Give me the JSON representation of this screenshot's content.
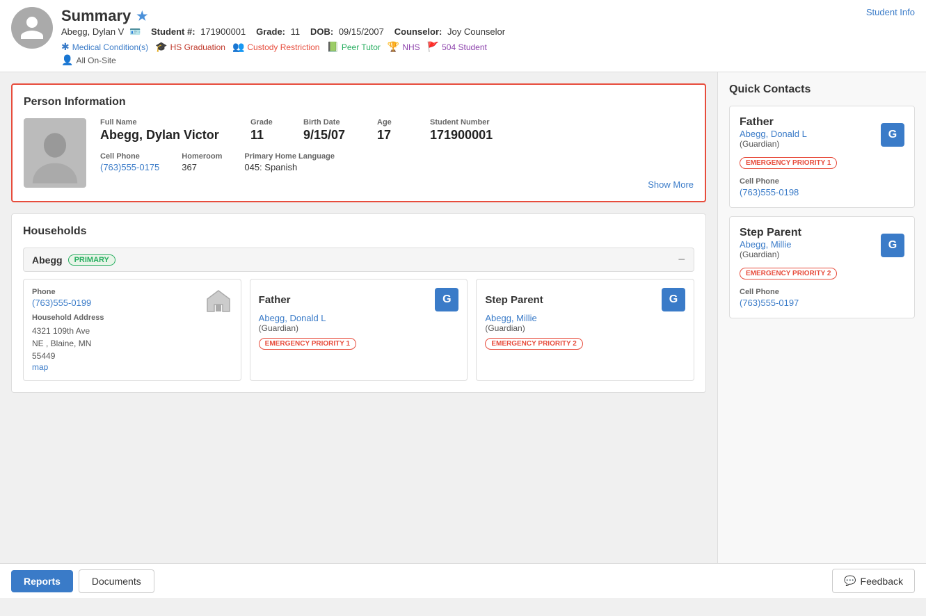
{
  "header": {
    "title": "Summary",
    "student_info_link": "Student Info",
    "student": {
      "name": "Abegg, Dylan V",
      "id_icon_label": "id-card-icon",
      "student_number_label": "Student #:",
      "student_number": "171900001",
      "grade_label": "Grade:",
      "grade": "11",
      "dob_label": "DOB:",
      "dob": "09/15/2007",
      "counselor_label": "Counselor:",
      "counselor": "Joy Counselor"
    },
    "badges": [
      {
        "id": "medical",
        "icon": "✱",
        "label": "Medical Condition(s)",
        "color": "#3a7bc8"
      },
      {
        "id": "graduation",
        "icon": "🎓",
        "label": "HS Graduation",
        "color": "#c0392b"
      },
      {
        "id": "custody",
        "icon": "👥",
        "label": "Custody Restriction",
        "color": "#e74c3c"
      },
      {
        "id": "tutor",
        "icon": "📗",
        "label": "Peer Tutor",
        "color": "#27ae60"
      },
      {
        "id": "nhs",
        "icon": "🏆",
        "label": "NHS",
        "color": "#8e44ad"
      },
      {
        "id": "504",
        "icon": "🚩",
        "label": "504 Student",
        "color": "#8e44ad"
      },
      {
        "id": "onsite",
        "icon": "👤",
        "label": "All On-Site",
        "color": "#555"
      }
    ]
  },
  "person_information": {
    "section_title": "Person Information",
    "full_name_label": "Full Name",
    "full_name": "Abegg, Dylan Victor",
    "grade_label": "Grade",
    "grade": "11",
    "birth_date_label": "Birth Date",
    "birth_date": "9/15/07",
    "age_label": "Age",
    "age": "17",
    "student_number_label": "Student Number",
    "student_number": "171900001",
    "cell_phone_label": "Cell Phone",
    "cell_phone": "(763)555-0175",
    "homeroom_label": "Homeroom",
    "homeroom": "367",
    "primary_language_label": "Primary Home Language",
    "primary_language": "045: Spanish",
    "show_more": "Show More"
  },
  "households": {
    "section_title": "Households",
    "household_name": "Abegg",
    "primary_label": "PRIMARY",
    "address_card": {
      "phone_label": "Phone",
      "phone": "(763)555-0199",
      "address_label": "Household Address",
      "address": "4321 109th Ave NE , Blaine, MN 55449",
      "map_link": "map"
    },
    "father_card": {
      "role": "Father",
      "name": "Abegg, Donald L",
      "sub": "(Guardian)",
      "emergency": "EMERGENCY PRIORITY 1",
      "avatar": "G"
    },
    "step_parent_card": {
      "role": "Step Parent",
      "name": "Abegg, Millie",
      "sub": "(Guardian)",
      "emergency": "EMERGENCY PRIORITY 2",
      "avatar": "G"
    }
  },
  "quick_contacts": {
    "section_title": "Quick Contacts",
    "contacts": [
      {
        "type": "Father",
        "name": "Abegg, Donald L",
        "sub": "(Guardian)",
        "emergency": "EMERGENCY PRIORITY 1",
        "phone_label": "Cell Phone",
        "phone": "(763)555-0198",
        "avatar": "G"
      },
      {
        "type": "Step Parent",
        "name": "Abegg, Millie",
        "sub": "(Guardian)",
        "emergency": "EMERGENCY PRIORITY 2",
        "phone_label": "Cell Phone",
        "phone": "(763)555-0197",
        "avatar": "G"
      }
    ]
  },
  "footer": {
    "reports_label": "Reports",
    "documents_label": "Documents",
    "feedback_label": "Feedback"
  }
}
